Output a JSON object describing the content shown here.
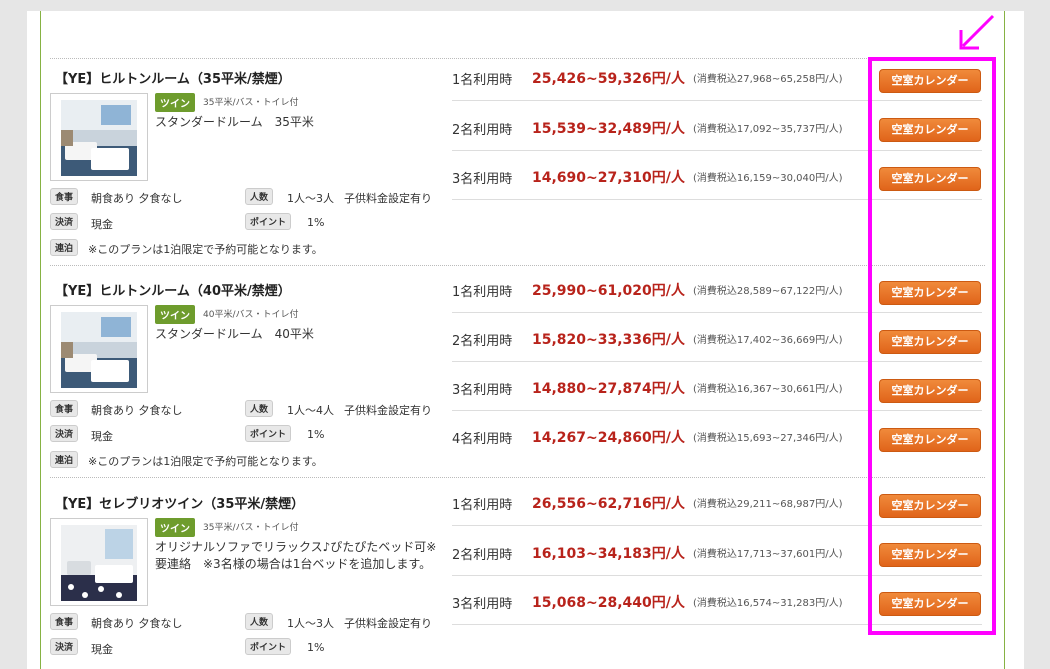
{
  "plans": [
    {
      "title": "【YE】ヒルトンルーム（35平米/禁煙）",
      "room_type": "ツイン",
      "room_spec": "35平米/バス・トイレ付",
      "description": "スタンダードルーム　35平米",
      "meal_label": "食事",
      "meal_value": "朝食あり 夕食なし",
      "people_label": "人数",
      "people_value": "1人～3人",
      "child_value": "子供料金設定有り",
      "payment_label": "決済",
      "payment_value": "現金",
      "points_label": "ポイント",
      "points_value": "1%",
      "stay_label": "連泊",
      "stay_value": "※このプランは1泊限定で予約可能となります。",
      "rates": [
        {
          "persons": "1名利用時",
          "price": "25,426~59,326円/人",
          "tax": "(消費税込27,968~65,258円/人)",
          "button": "空室カレンダー"
        },
        {
          "persons": "2名利用時",
          "price": "15,539~32,489円/人",
          "tax": "(消費税込17,092~35,737円/人)",
          "button": "空室カレンダー"
        },
        {
          "persons": "3名利用時",
          "price": "14,690~27,310円/人",
          "tax": "(消費税込16,159~30,040円/人)",
          "button": "空室カレンダー"
        }
      ]
    },
    {
      "title": "【YE】ヒルトンルーム（40平米/禁煙）",
      "room_type": "ツイン",
      "room_spec": "40平米/バス・トイレ付",
      "description": "スタンダードルーム　40平米",
      "meal_label": "食事",
      "meal_value": "朝食あり 夕食なし",
      "people_label": "人数",
      "people_value": "1人～4人",
      "child_value": "子供料金設定有り",
      "payment_label": "決済",
      "payment_value": "現金",
      "points_label": "ポイント",
      "points_value": "1%",
      "stay_label": "連泊",
      "stay_value": "※このプランは1泊限定で予約可能となります。",
      "rates": [
        {
          "persons": "1名利用時",
          "price": "25,990~61,020円/人",
          "tax": "(消費税込28,589~67,122円/人)",
          "button": "空室カレンダー"
        },
        {
          "persons": "2名利用時",
          "price": "15,820~33,336円/人",
          "tax": "(消費税込17,402~36,669円/人)",
          "button": "空室カレンダー"
        },
        {
          "persons": "3名利用時",
          "price": "14,880~27,874円/人",
          "tax": "(消費税込16,367~30,661円/人)",
          "button": "空室カレンダー"
        },
        {
          "persons": "4名利用時",
          "price": "14,267~24,860円/人",
          "tax": "(消費税込15,693~27,346円/人)",
          "button": "空室カレンダー"
        }
      ]
    },
    {
      "title": "【YE】セレブリオツイン（35平米/禁煙）",
      "room_type": "ツイン",
      "room_spec": "35平米/バス・トイレ付",
      "description": "オリジナルソファでリラックス♪ぴたぴたベッド可※要連絡　※3名様の場合は1台ベッドを追加します。",
      "meal_label": "食事",
      "meal_value": "朝食あり 夕食なし",
      "people_label": "人数",
      "people_value": "1人～3人",
      "child_value": "子供料金設定有り",
      "payment_label": "決済",
      "payment_value": "現金",
      "points_label": "ポイント",
      "points_value": "1%",
      "rates": [
        {
          "persons": "1名利用時",
          "price": "26,556~62,716円/人",
          "tax": "(消費税込29,211~68,987円/人)",
          "button": "空室カレンダー"
        },
        {
          "persons": "2名利用時",
          "price": "16,103~34,183円/人",
          "tax": "(消費税込17,713~37,601円/人)",
          "button": "空室カレンダー"
        },
        {
          "persons": "3名利用時",
          "price": "15,068~28,440円/人",
          "tax": "(消費税込16,574~31,283円/人)",
          "button": "空室カレンダー"
        }
      ]
    }
  ],
  "colors": {
    "price": "#b8231b",
    "button": "#e8741f",
    "highlight": "#ff00ff",
    "room_type_badge": "#6e9c2d",
    "frame_line": "#86b243"
  },
  "icons": {
    "annotation": "arrow-down-left-icon"
  }
}
